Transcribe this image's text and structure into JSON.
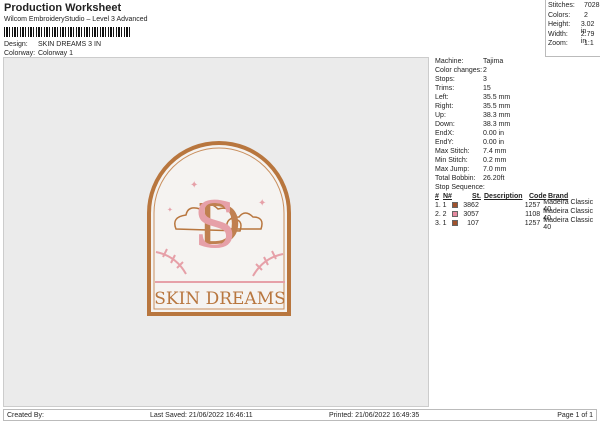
{
  "header": {
    "title": "Production Worksheet",
    "subtitle": "Wilcom EmbroideryStudio – Level 3 Advanced",
    "design_label": "Design:",
    "design_value": "SKIN DREAMS 3 IN",
    "colorway_label": "Colorway:",
    "colorway_value": "Colorway 1"
  },
  "summary": [
    {
      "k": "Stitches:",
      "v": "7028"
    },
    {
      "k": "Colors:",
      "v": "2"
    },
    {
      "k": "Height:",
      "v": "3.02 in"
    },
    {
      "k": "Width:",
      "v": "2.79 in"
    },
    {
      "k": "Zoom:",
      "v": "1:1"
    }
  ],
  "design": {
    "text": "SKIN DREAMS",
    "monogram": "SD",
    "colors": {
      "tan": "#b8763e",
      "pink": "#e6a0a8"
    }
  },
  "info": [
    {
      "k": "Machine:",
      "v": "Tajima"
    },
    {
      "k": "Color changes:",
      "v": "2"
    },
    {
      "k": "Stops:",
      "v": "3"
    },
    {
      "k": "Trims:",
      "v": "15"
    },
    {
      "k": "Left:",
      "v": "35.5 mm"
    },
    {
      "k": "Right:",
      "v": "35.5 mm"
    },
    {
      "k": "Up:",
      "v": "38.3 mm"
    },
    {
      "k": "Down:",
      "v": "38.3 mm"
    },
    {
      "k": "EndX:",
      "v": "0.00 in"
    },
    {
      "k": "EndY:",
      "v": "0.00 in"
    },
    {
      "k": "Max Stitch:",
      "v": "7.4 mm"
    },
    {
      "k": "Min Stitch:",
      "v": "0.2 mm"
    },
    {
      "k": "Max Jump:",
      "v": "7.0 mm"
    },
    {
      "k": "Total Bobbin:",
      "v": "26.20ft"
    }
  ],
  "stop_sequence": {
    "label": "Stop Sequence:",
    "headers": [
      "#",
      "N#",
      "St.",
      "Description",
      "Code",
      "Brand"
    ],
    "rows": [
      {
        "n": "1.",
        "nn": "1",
        "color": "#a0522d",
        "st": "3862",
        "desc": "",
        "code": "1257",
        "brand": "Madeira Classic 40"
      },
      {
        "n": "2.",
        "nn": "2",
        "color": "#e68aa0",
        "st": "3057",
        "desc": "",
        "code": "1108",
        "brand": "Madeira Classic 40"
      },
      {
        "n": "3.",
        "nn": "1",
        "color": "#a0522d",
        "st": "107",
        "desc": "",
        "code": "1257",
        "brand": "Madeira Classic 40"
      }
    ]
  },
  "footer": {
    "created": "Created By:",
    "saved": "Last Saved: 21/06/2022 16:46:11",
    "printed": "Printed: 21/06/2022 16:49:35",
    "page": "Page 1 of 1"
  }
}
